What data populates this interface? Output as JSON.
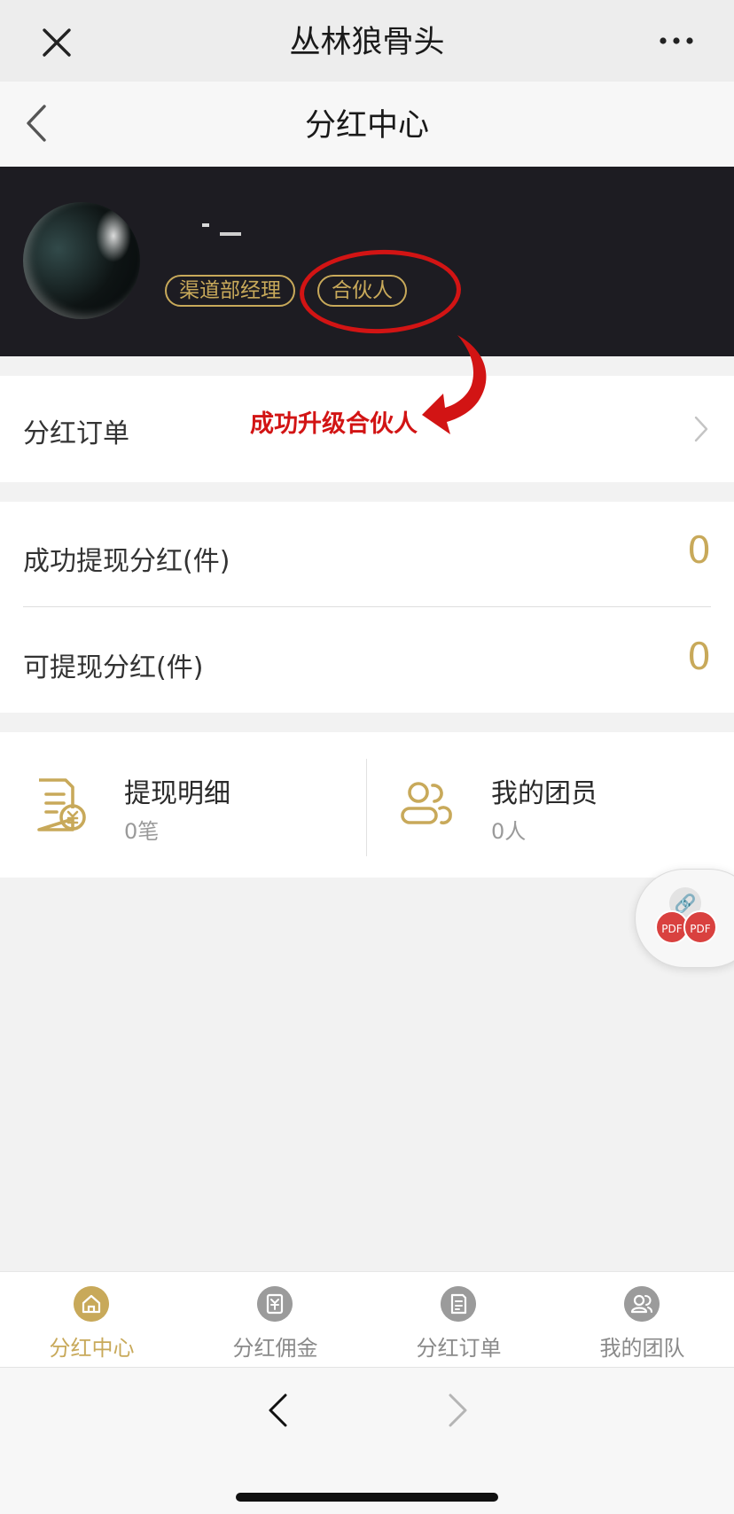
{
  "app_bar": {
    "title": "丛林狼骨头",
    "close_icon": "close-icon",
    "more_icon": "more-dots-icon"
  },
  "page_nav": {
    "title": "分红中心",
    "back_icon": "back-arrow-icon"
  },
  "profile": {
    "badges": [
      "渠道部经理",
      "合伙人"
    ]
  },
  "annotation": {
    "text": "成功升级合伙人",
    "color": "#d21414"
  },
  "orders_row": {
    "label": "分红订单"
  },
  "stats": [
    {
      "label": "成功提现分红(件)",
      "value": "0"
    },
    {
      "label": "可提现分红(件)",
      "value": "0"
    }
  ],
  "details": [
    {
      "title": "提现明细",
      "sub": "0笔",
      "icon": "withdraw-document-icon"
    },
    {
      "title": "我的团员",
      "sub": "0人",
      "icon": "team-members-icon"
    }
  ],
  "floating_widget": {
    "link_icon": "link-icon",
    "pdf_labels": [
      "PDF",
      "PDF"
    ]
  },
  "tabs": [
    {
      "label": "分红中心",
      "icon": "home-icon",
      "active": true
    },
    {
      "label": "分红佣金",
      "icon": "commission-icon",
      "active": false
    },
    {
      "label": "分红订单",
      "icon": "order-icon",
      "active": false
    },
    {
      "label": "我的团队",
      "icon": "team-icon",
      "active": false
    }
  ],
  "colors": {
    "accent_gold": "#c8a95a",
    "header_bg": "#1d1c22",
    "annotation_red": "#d21414"
  }
}
